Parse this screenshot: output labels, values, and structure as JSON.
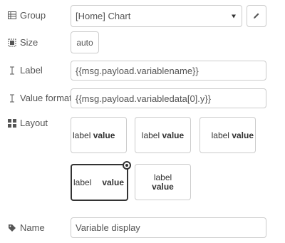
{
  "group": {
    "label": "Group",
    "icon": "table-icon",
    "value": "[Home] Chart",
    "edit_icon": "pencil-icon"
  },
  "size": {
    "label": "Size",
    "icon": "size-icon",
    "value": "auto"
  },
  "label_field": {
    "label": "Label",
    "icon": "text-cursor-icon",
    "value": "{{msg.payload.variablename}}"
  },
  "value_format": {
    "label": "Value format",
    "icon": "text-cursor-icon",
    "value": "{{msg.payload.variabledata[0].y}}"
  },
  "layout": {
    "label": "Layout",
    "icon": "grid-icon",
    "options": [
      {
        "label": "label",
        "value": "value"
      },
      {
        "label": "label",
        "value": "value"
      },
      {
        "label": "label",
        "value": "value"
      },
      {
        "label": "label",
        "value": "value"
      },
      {
        "label": "label",
        "value": "value"
      }
    ],
    "selected_index": 3
  },
  "name": {
    "label": "Name",
    "icon": "tag-icon",
    "value": "Variable display"
  },
  "colors": {
    "border": "#cccccc",
    "label_text": "#555555",
    "selected_border": "#333333"
  }
}
